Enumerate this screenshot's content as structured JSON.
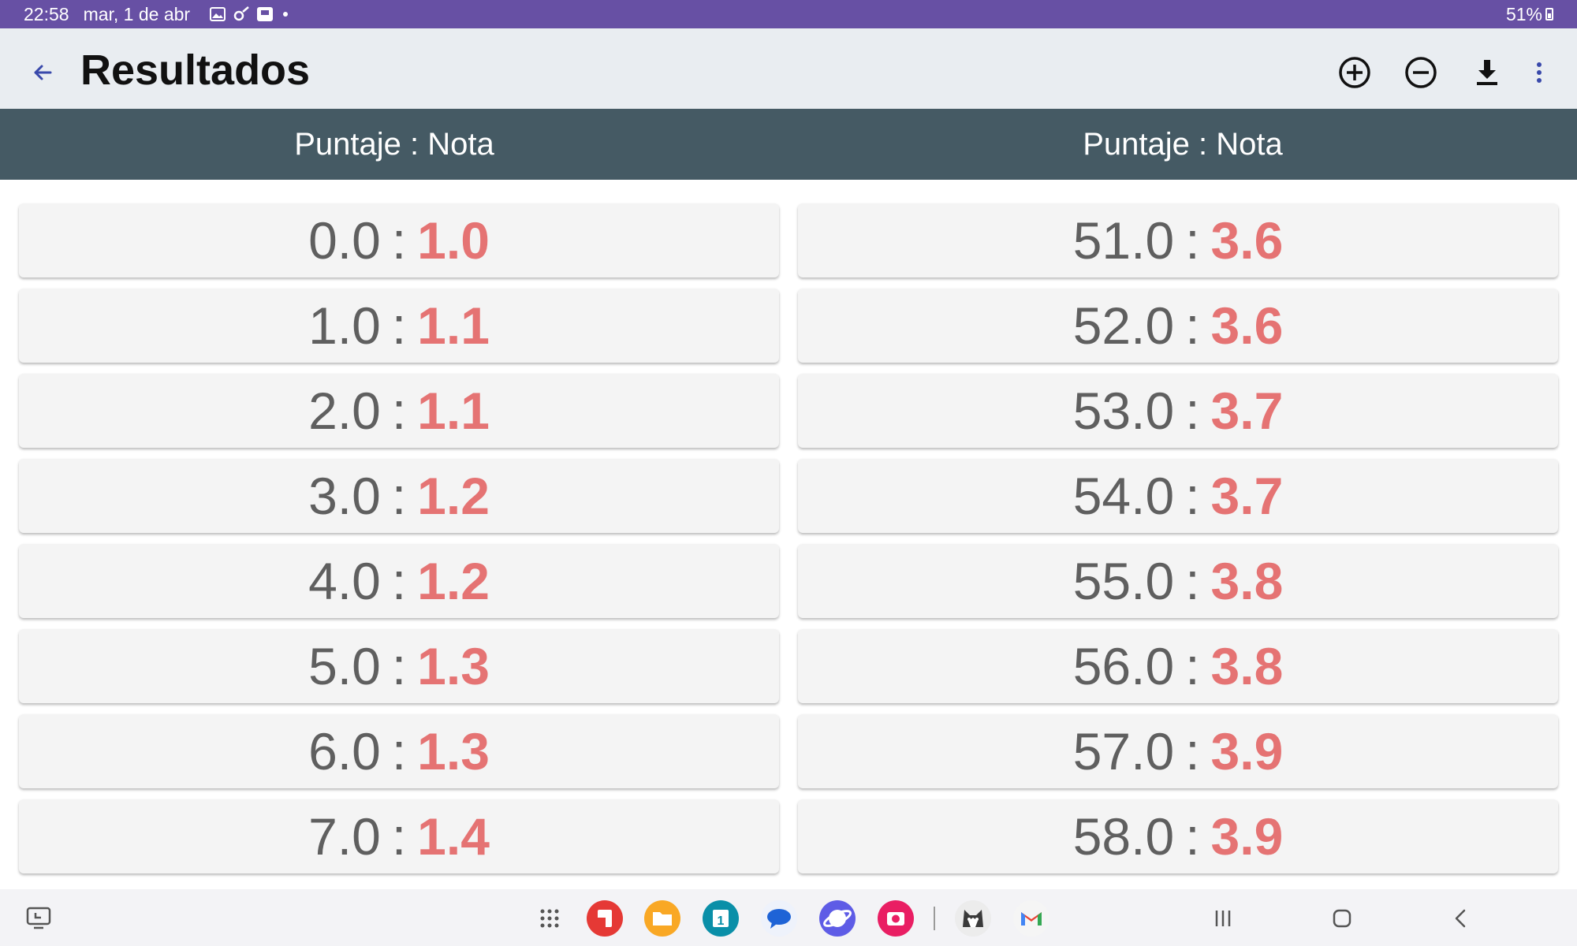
{
  "status_bar": {
    "time": "22:58",
    "date": "mar, 1 de abr",
    "battery": "51%",
    "icons": [
      "image-icon",
      "settings-sync-icon",
      "app-notification-icon",
      "dot-icon"
    ]
  },
  "app_bar": {
    "title": "Resultados",
    "actions": [
      "plus-circle-icon",
      "minus-circle-icon",
      "download-icon",
      "more-vert-icon"
    ]
  },
  "table": {
    "headers": [
      "Puntaje : Nota",
      "Puntaje : Nota"
    ],
    "separator": ":",
    "left": [
      {
        "score": "0.0",
        "grade": "1.0"
      },
      {
        "score": "1.0",
        "grade": "1.1"
      },
      {
        "score": "2.0",
        "grade": "1.1"
      },
      {
        "score": "3.0",
        "grade": "1.2"
      },
      {
        "score": "4.0",
        "grade": "1.2"
      },
      {
        "score": "5.0",
        "grade": "1.3"
      },
      {
        "score": "6.0",
        "grade": "1.3"
      },
      {
        "score": "7.0",
        "grade": "1.4"
      }
    ],
    "right": [
      {
        "score": "51.0",
        "grade": "3.6"
      },
      {
        "score": "52.0",
        "grade": "3.6"
      },
      {
        "score": "53.0",
        "grade": "3.7"
      },
      {
        "score": "54.0",
        "grade": "3.7"
      },
      {
        "score": "55.0",
        "grade": "3.8"
      },
      {
        "score": "56.0",
        "grade": "3.8"
      },
      {
        "score": "57.0",
        "grade": "3.9"
      },
      {
        "score": "58.0",
        "grade": "3.9"
      }
    ]
  },
  "taskbar": {
    "apps": [
      "apps-grid-icon",
      "notes-app-icon",
      "files-app-icon",
      "calendar-app-icon",
      "messages-app-icon",
      "browser-app-icon",
      "camera-app-icon",
      "cat-app-icon",
      "gmail-icon"
    ],
    "calendar_day": "1",
    "nav": [
      "recents-icon",
      "home-icon",
      "back-nav-icon"
    ]
  },
  "colors": {
    "status_bar": "#6750A4",
    "app_bar": "#E9EDF1",
    "header": "#455A64",
    "grade": "#E57373",
    "score": "#5F5F5F"
  }
}
